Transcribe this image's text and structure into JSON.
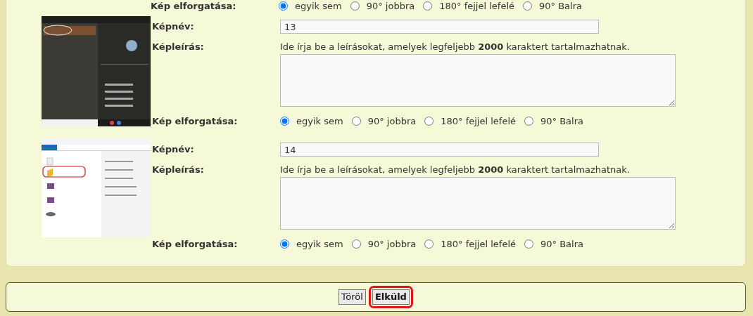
{
  "top_rotation": {
    "label": "Kép elforgatása:",
    "options": [
      {
        "label": "egyik sem",
        "selected": true
      },
      {
        "label": "90° jobbra",
        "selected": false
      },
      {
        "label": "180° fejjel lefelé",
        "selected": false
      },
      {
        "label": "90° Balra",
        "selected": false
      }
    ]
  },
  "images": [
    {
      "name_label": "Képnév:",
      "name_value": "13",
      "description_label": "Képleírás:",
      "description_hint": "Ide írja be a leírásokat, amelyek legfeljebb **2000** karaktert tartalmazhatnak.",
      "rotation_label": "Kép elforgatása:",
      "rotation_options": [
        {
          "label": "egyik sem",
          "selected": true
        },
        {
          "label": "90° jobbra",
          "selected": false
        },
        {
          "label": "180° fejjel lefelé",
          "selected": false
        },
        {
          "label": "90° Balra",
          "selected": false
        }
      ]
    },
    {
      "name_label": "Képnév:",
      "name_value": "14",
      "description_label": "Képleírás:",
      "description_hint": "Ide írja be a leírásokat, amelyek legfeljebb **2000** karaktert tartalmazhatnak.",
      "rotation_label": "Kép elforgatása:",
      "rotation_options": [
        {
          "label": "egyik sem",
          "selected": true
        },
        {
          "label": "90° jobbra",
          "selected": false
        },
        {
          "label": "180° fejjel lefelé",
          "selected": false
        },
        {
          "label": "90° Balra",
          "selected": false
        }
      ]
    }
  ],
  "buttons": [
    {
      "label": "Töröl",
      "default": false,
      "circled": false
    },
    {
      "label": "Elküld",
      "default": true,
      "circled": true
    }
  ]
}
